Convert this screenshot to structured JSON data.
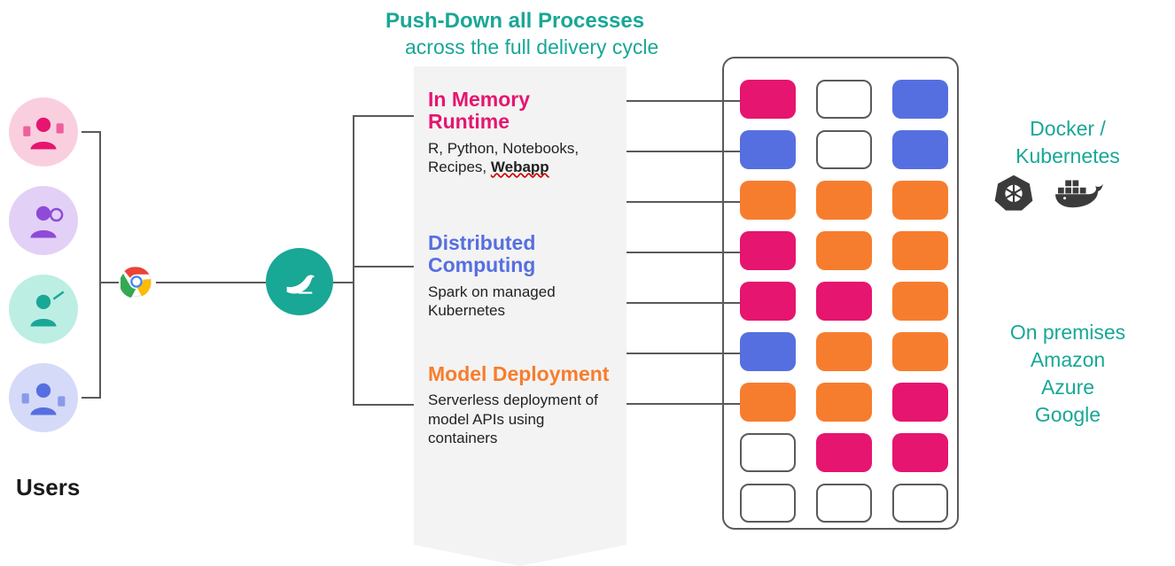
{
  "headline": {
    "line1": "Push-Down all Processes",
    "line2": "across the full delivery cycle"
  },
  "users_label": "Users",
  "sections": {
    "memory": {
      "title": "In Memory Runtime",
      "desc_pre": "R, Python, Notebooks, Recipes, ",
      "desc_bold": "Webapp"
    },
    "compute": {
      "title": "Distributed Computing",
      "desc": "Spark on managed Kubernetes"
    },
    "deploy": {
      "title": "Model Deployment",
      "desc": "Serverless deployment of model APIs using containers"
    }
  },
  "right": {
    "orchestration": "Docker / Kubernetes",
    "hosting": "On premises\nAmazon\nAzure\nGoogle"
  },
  "grid": {
    "cols": 3,
    "rows": 9,
    "cells": [
      [
        "pink",
        "empty",
        "blue"
      ],
      [
        "blue",
        "empty",
        "blue"
      ],
      [
        "orange",
        "orange",
        "orange"
      ],
      [
        "pink",
        "orange",
        "orange"
      ],
      [
        "pink",
        "pink",
        "orange"
      ],
      [
        "blue",
        "orange",
        "orange"
      ],
      [
        "orange",
        "orange",
        "pink"
      ],
      [
        "empty",
        "pink",
        "pink"
      ],
      [
        "empty",
        "empty",
        "empty"
      ]
    ]
  },
  "icons": {
    "chrome": "chrome-icon",
    "dataiku": "dataiku-bird-icon",
    "kubernetes": "kubernetes-icon",
    "docker": "docker-icon"
  }
}
